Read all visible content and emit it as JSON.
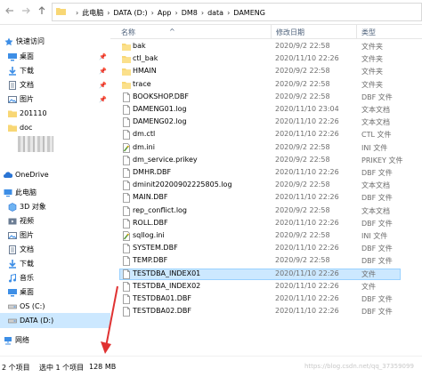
{
  "address": {
    "crumbs": [
      "此电脑",
      "DATA (D:)",
      "App",
      "DM8",
      "data",
      "DAMENG"
    ],
    "back_icon": "left-arrow-icon",
    "forward_icon": "right-arrow-icon",
    "up_icon": "up-arrow-icon"
  },
  "nav": {
    "quick_access": "快速访问",
    "desktop_pinned": "桌面",
    "downloads_pinned": "下载",
    "documents_pinned": "文档",
    "pictures_pinned": "图片",
    "folder_201110": "201110",
    "folder_doc": "doc",
    "onedrive": "OneDrive",
    "this_pc": "此电脑",
    "objects_3d": "3D 对象",
    "videos": "视频",
    "pictures": "图片",
    "documents": "文档",
    "downloads": "下载",
    "music": "音乐",
    "desktop": "桌面",
    "drive_c": "OS (C:)",
    "drive_d": "DATA (D:)",
    "network": "网络"
  },
  "columns": {
    "name": "名称",
    "date": "修改日期",
    "type": "类型"
  },
  "files": [
    {
      "name": "bak",
      "date": "2020/9/2 22:58",
      "type": "文件夹",
      "kind": "folder"
    },
    {
      "name": "ctl_bak",
      "date": "2020/11/10 22:26",
      "type": "文件夹",
      "kind": "folder"
    },
    {
      "name": "HMAIN",
      "date": "2020/9/2 22:58",
      "type": "文件夹",
      "kind": "folder"
    },
    {
      "name": "trace",
      "date": "2020/9/2 22:58",
      "type": "文件夹",
      "kind": "folder"
    },
    {
      "name": "BOOKSHOP.DBF",
      "date": "2020/9/2 22:58",
      "type": "DBF 文件",
      "kind": "file"
    },
    {
      "name": "DAMENG01.log",
      "date": "2020/11/10 23:04",
      "type": "文本文档",
      "kind": "file"
    },
    {
      "name": "DAMENG02.log",
      "date": "2020/11/10 22:26",
      "type": "文本文档",
      "kind": "file"
    },
    {
      "name": "dm.ctl",
      "date": "2020/11/10 22:26",
      "type": "CTL 文件",
      "kind": "file"
    },
    {
      "name": "dm.ini",
      "date": "2020/9/2 22:58",
      "type": "INI 文件",
      "kind": "ini"
    },
    {
      "name": "dm_service.prikey",
      "date": "2020/9/2 22:58",
      "type": "PRIKEY 文件",
      "kind": "file"
    },
    {
      "name": "DMHR.DBF",
      "date": "2020/11/10 22:26",
      "type": "DBF 文件",
      "kind": "file"
    },
    {
      "name": "dminit20200902225805.log",
      "date": "2020/9/2 22:58",
      "type": "文本文档",
      "kind": "file"
    },
    {
      "name": "MAIN.DBF",
      "date": "2020/11/10 22:26",
      "type": "DBF 文件",
      "kind": "file"
    },
    {
      "name": "rep_conflict.log",
      "date": "2020/9/2 22:58",
      "type": "文本文档",
      "kind": "file"
    },
    {
      "name": "ROLL.DBF",
      "date": "2020/11/10 22:26",
      "type": "DBF 文件",
      "kind": "file"
    },
    {
      "name": "sqllog.ini",
      "date": "2020/9/2 22:58",
      "type": "INI 文件",
      "kind": "ini"
    },
    {
      "name": "SYSTEM.DBF",
      "date": "2020/11/10 22:26",
      "type": "DBF 文件",
      "kind": "file"
    },
    {
      "name": "TEMP.DBF",
      "date": "2020/9/2 22:58",
      "type": "DBF 文件",
      "kind": "file"
    },
    {
      "name": "TESTDBA_INDEX01",
      "date": "2020/11/10 22:26",
      "type": "文件",
      "kind": "file",
      "selected": true
    },
    {
      "name": "TESTDBA_INDEX02",
      "date": "2020/11/10 22:26",
      "type": "文件",
      "kind": "file"
    },
    {
      "name": "TESTDBA01.DBF",
      "date": "2020/11/10 22:26",
      "type": "DBF 文件",
      "kind": "file"
    },
    {
      "name": "TESTDBA02.DBF",
      "date": "2020/11/10 22:26",
      "type": "DBF 文件",
      "kind": "file"
    }
  ],
  "status": {
    "item_count": "2 个项目",
    "selected": "选中 1 个项目",
    "size": "128 MB",
    "watermark": "https://blog.csdn.net/qq_37359099"
  },
  "colors": {
    "selection": "#cce8ff",
    "selection_border": "#99d1ff",
    "folder": "#f8d775",
    "arrow": "#e03232"
  }
}
